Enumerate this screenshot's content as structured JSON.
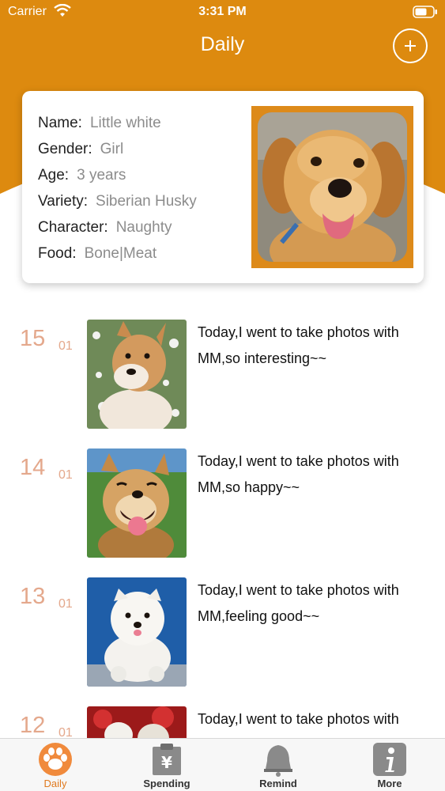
{
  "status_bar": {
    "carrier": "Carrier",
    "time": "3:31 PM"
  },
  "nav": {
    "title": "Daily",
    "add_icon": "plus-circle-icon"
  },
  "colors": {
    "accent": "#dd8a0f",
    "date": "#e4a88c",
    "active_tab": "#e07a1f"
  },
  "pet": {
    "fields": [
      {
        "label": "Name:",
        "value": "Little white"
      },
      {
        "label": "Gender:",
        "value": "Girl"
      },
      {
        "label": "Age:",
        "value": "3 years"
      },
      {
        "label": "Variety:",
        "value": "Siberian Husky"
      },
      {
        "label": "Character:",
        "value": "Naughty"
      },
      {
        "label": "Food:",
        "value": "Bone|Meat"
      }
    ]
  },
  "entries": [
    {
      "day": "15",
      "month": "01",
      "text": "Today,I went to take photos with MM,so interesting~~"
    },
    {
      "day": "14",
      "month": "01",
      "text": "Today,I went to take photos with MM,so happy~~"
    },
    {
      "day": "13",
      "month": "01",
      "text": "Today,I went to take photos with MM,feeling good~~"
    },
    {
      "day": "12",
      "month": "01",
      "text": "Today,I went to take photos with MM,so nice~~"
    }
  ],
  "tabs": [
    {
      "label": "Daily",
      "icon": "paw-icon",
      "active": true
    },
    {
      "label": "Spending",
      "icon": "clipboard-yen-icon",
      "active": false
    },
    {
      "label": "Remind",
      "icon": "bell-icon",
      "active": false
    },
    {
      "label": "More",
      "icon": "info-icon",
      "active": false
    }
  ]
}
